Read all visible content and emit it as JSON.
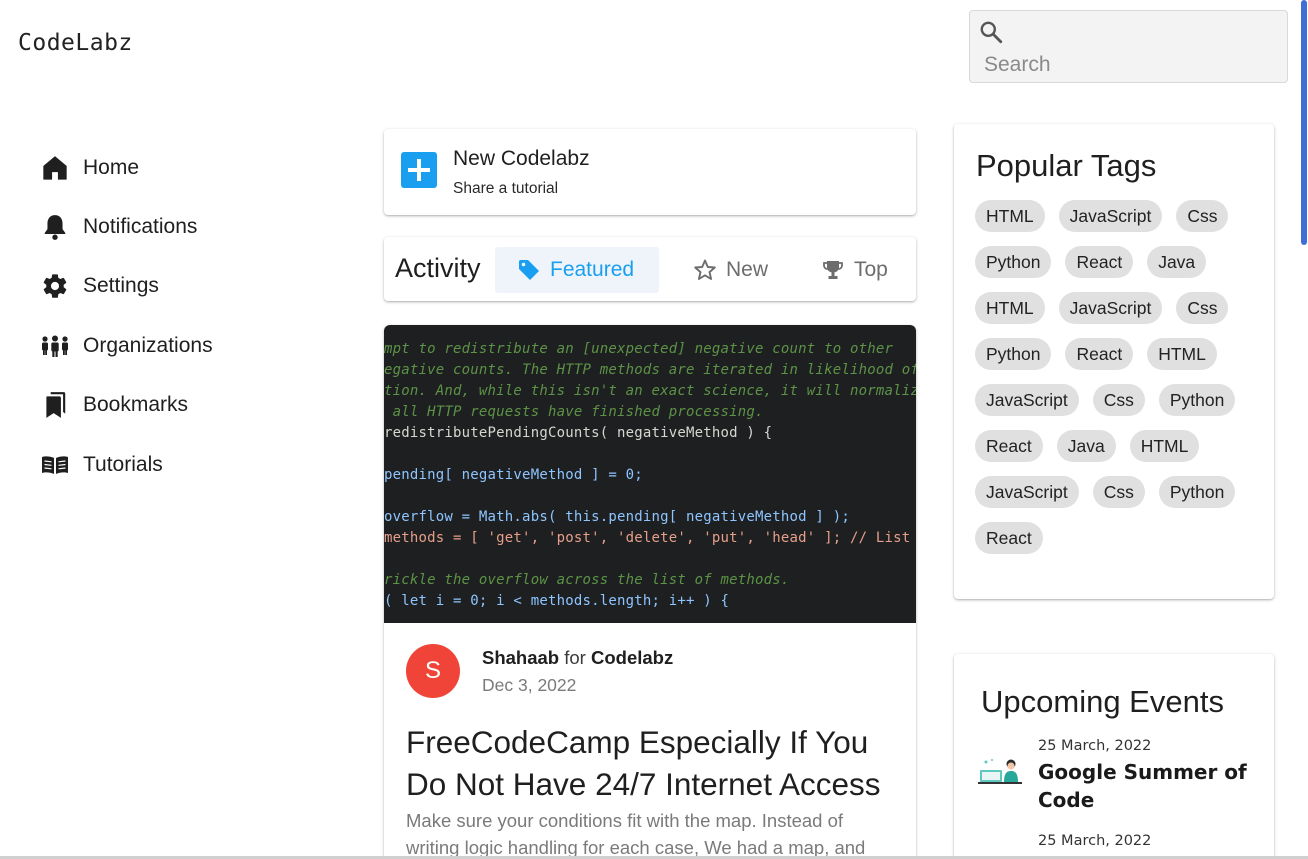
{
  "header": {
    "logo": "CodeLabz",
    "search_placeholder": "Search"
  },
  "sidebar": {
    "items": [
      {
        "label": "Home",
        "icon": "home-icon"
      },
      {
        "label": "Notifications",
        "icon": "bell-icon"
      },
      {
        "label": "Settings",
        "icon": "gear-icon"
      },
      {
        "label": "Organizations",
        "icon": "people-icon"
      },
      {
        "label": "Bookmarks",
        "icon": "bookmarks-icon"
      },
      {
        "label": "Tutorials",
        "icon": "book-icon"
      }
    ]
  },
  "new_codelabz": {
    "title": "New Codelabz",
    "subtitle": "Share a tutorial",
    "icon": "plus-icon",
    "accent": "#1a9ff0"
  },
  "activity": {
    "heading": "Activity",
    "tabs": [
      {
        "label": "Featured",
        "icon": "tag-icon",
        "active": true
      },
      {
        "label": "New",
        "icon": "star-icon",
        "active": false
      },
      {
        "label": "Top",
        "icon": "trophy-icon",
        "active": false
      }
    ]
  },
  "post": {
    "code_lines": [
      "mpt to redistribute an [unexpected] negative count to other",
      "egative counts. The HTTP methods are iterated in likelihood of",
      "tion. And, while this isn't an exact science, it will normalize",
      " all HTTP requests have finished processing.",
      "redistributePendingCounts( negativeMethod ) {",
      "",
      "pending[ negativeMethod ] = 0;",
      "",
      "overflow = Math.abs( this.pending[ negativeMethod ] );",
      "methods = [ 'get', 'post', 'delete', 'put', 'head' ]; // List",
      "",
      "rickle the overflow across the list of methods.",
      "( let i = 0; i < methods.length; i++ ) {"
    ],
    "avatar_letter": "S",
    "avatar_color": "#f04438",
    "author": "Shahaab",
    "for_text": "for",
    "org": "Codelabz",
    "date": "Dec 3, 2022",
    "title": "FreeCodeCamp Especially If You Do Not Have 24/7 Internet Access",
    "excerpt": "Make sure your conditions fit with the map. Instead of writing logic handling for each case, We had a map, and"
  },
  "popular_tags": {
    "heading": "Popular Tags",
    "tags": [
      "HTML",
      "JavaScript",
      "Css",
      "Python",
      "React",
      "Java",
      "HTML",
      "JavaScript",
      "Css",
      "Python",
      "React",
      "HTML",
      "JavaScript",
      "Css",
      "Python",
      "React",
      "Java",
      "HTML",
      "JavaScript",
      "Css",
      "Python",
      "React"
    ]
  },
  "events": {
    "heading": "Upcoming Events",
    "items": [
      {
        "date": "25 March, 2022",
        "name": "Google Summer of Code"
      },
      {
        "date": "25 March, 2022",
        "name": ""
      }
    ]
  }
}
